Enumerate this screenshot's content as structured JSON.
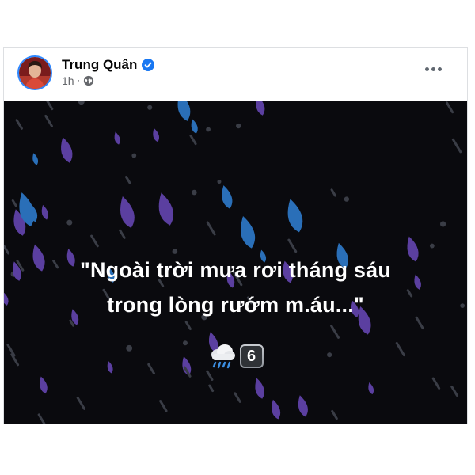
{
  "post": {
    "author": "Trung Quân",
    "time": "1h",
    "privacy_icon": "globe-icon",
    "verified_icon": "verified-badge-icon",
    "more_icon": "more-options-icon",
    "quote_line1": "\"Ngoài trời mưa rơi tháng sáu",
    "quote_line2": "trong lòng rướm m.áu...\"",
    "emoji_icon": "cloud-rain-emoji",
    "keycap_number": "6"
  },
  "colors": {
    "background": "#0a0a0e",
    "verified": "#1877f2",
    "avatar_ring": "#2d88ff",
    "drop_purple": "#5b3fa0",
    "drop_blue": "#2a6fb8",
    "drop_grey": "#3a3d46"
  }
}
